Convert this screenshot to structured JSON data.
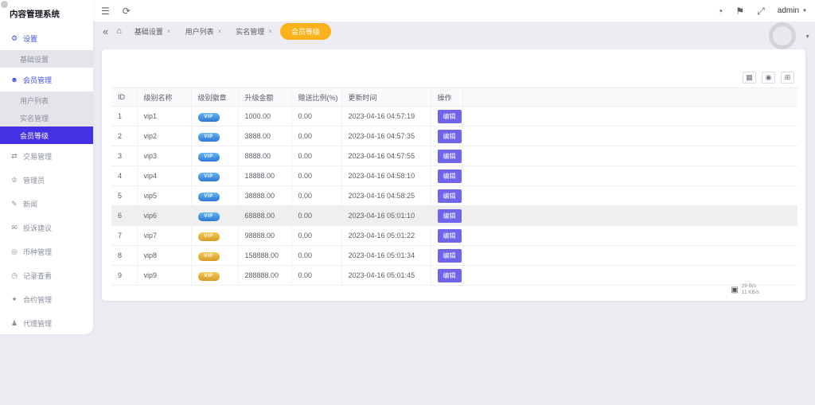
{
  "app": {
    "title": "内容管理系统"
  },
  "topbar": {
    "admin_label": "admin"
  },
  "sidebar": {
    "items": [
      {
        "key": "settings",
        "label": "设置",
        "icon": "gear",
        "type": "section",
        "colored": true
      },
      {
        "key": "basic-settings",
        "label": "基础设置",
        "type": "sub"
      },
      {
        "key": "member-management",
        "label": "会员管理",
        "icon": "users",
        "type": "section",
        "colored": true
      },
      {
        "key": "user-list",
        "label": "用户列表",
        "type": "sub"
      },
      {
        "key": "realname-management",
        "label": "实名管理",
        "type": "sub"
      },
      {
        "key": "member-level",
        "label": "会员等级",
        "type": "sub",
        "active": true
      },
      {
        "key": "transaction-management",
        "label": "交易管理",
        "icon": "transaction",
        "type": "section"
      },
      {
        "key": "administrator",
        "label": "管理员",
        "icon": "admin",
        "type": "section"
      },
      {
        "key": "news",
        "label": "新闻",
        "icon": "news",
        "type": "section"
      },
      {
        "key": "feedback",
        "label": "投诉建议",
        "icon": "feedback",
        "type": "section"
      },
      {
        "key": "currency-management",
        "label": "币种管理",
        "icon": "coin",
        "type": "section"
      },
      {
        "key": "record-view",
        "label": "记录查看",
        "icon": "record",
        "type": "section"
      },
      {
        "key": "contract-management",
        "label": "合约管理",
        "icon": "contract",
        "type": "section"
      },
      {
        "key": "agent-management",
        "label": "代理管理",
        "icon": "agent",
        "type": "section"
      }
    ]
  },
  "tabs": [
    {
      "key": "basic-settings",
      "label": "基础设置",
      "closable": true
    },
    {
      "key": "user-list",
      "label": "用户列表",
      "closable": true
    },
    {
      "key": "realname-management",
      "label": "实名管理",
      "closable": true
    },
    {
      "key": "member-level",
      "label": "会员等级",
      "active": true
    }
  ],
  "table": {
    "headers": [
      "ID",
      "级别名称",
      "级别徽章",
      "升级金额",
      "赠送比例(%)",
      "更新时间",
      "操作"
    ],
    "edit_label": "编辑",
    "badge_text": "VIP",
    "rows": [
      {
        "id": "1",
        "name": "vip1",
        "badge": "blue",
        "amount": "1000.00",
        "ratio": "0.00",
        "updated": "2023-04-16 04:57:19"
      },
      {
        "id": "2",
        "name": "vip2",
        "badge": "blue",
        "amount": "3888.00",
        "ratio": "0.00",
        "updated": "2023-04-16 04:57:35"
      },
      {
        "id": "3",
        "name": "vip3",
        "badge": "blue",
        "amount": "8888.00",
        "ratio": "0.00",
        "updated": "2023-04-16 04:57:55"
      },
      {
        "id": "4",
        "name": "vip4",
        "badge": "blue",
        "amount": "18888.00",
        "ratio": "0.00",
        "updated": "2023-04-16 04:58:10"
      },
      {
        "id": "5",
        "name": "vip5",
        "badge": "blue",
        "amount": "38888.00",
        "ratio": "0.00",
        "updated": "2023-04-16 04:58:25"
      },
      {
        "id": "6",
        "name": "vip6",
        "badge": "blue",
        "amount": "68888.00",
        "ratio": "0.00",
        "updated": "2023-04-16 05:01:10",
        "highlighted": true
      },
      {
        "id": "7",
        "name": "vip7",
        "badge": "gold",
        "amount": "98888.00",
        "ratio": "0.00",
        "updated": "2023-04-16 05:01:22"
      },
      {
        "id": "8",
        "name": "vip8",
        "badge": "gold",
        "amount": "158888.00",
        "ratio": "0.00",
        "updated": "2023-04-16 05:01:34"
      },
      {
        "id": "9",
        "name": "vip9",
        "badge": "gold",
        "amount": "288888.00",
        "ratio": "0.00",
        "updated": "2023-04-16 05:01:45"
      }
    ]
  },
  "stats": {
    "upload": "29 B/s",
    "download": "11 KB/s"
  }
}
